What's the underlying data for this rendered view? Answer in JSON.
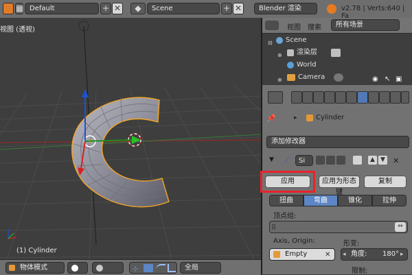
{
  "top_bar": {
    "layout_value": "Default",
    "scene_value": "Scene",
    "engine_value": "Blender 渲染",
    "stats": "v2.78 | Verts:640 | Fa"
  },
  "viewport": {
    "title": "视图 (透视)",
    "object_name": "(1) Cylinder"
  },
  "bottom_bar": {
    "mode_value": "物体模式",
    "orientation_value": "全局"
  },
  "outliner": {
    "menu": [
      "视图",
      "搜索"
    ],
    "filter_value": "所有场景",
    "items": [
      {
        "label": "Scene"
      },
      {
        "label": "渲染层"
      },
      {
        "label": "World"
      },
      {
        "label": "Camera"
      }
    ]
  },
  "properties": {
    "object_name": "Cylinder",
    "add_modifier": "添加修改器",
    "modifier_name": "Si",
    "apply_button": "应用",
    "apply_shape_button": "应用为形态键",
    "copy_button": "复制",
    "deform_modes": [
      "扭曲",
      "弯曲",
      "锥化",
      "拉伸"
    ],
    "selected_mode": "弯曲",
    "vertex_group_label": "顶点组:",
    "axis_origin_label": "Axis, Origin:",
    "deform_label": "形变:",
    "origin_value": "Empty",
    "angle_label": "角度:",
    "angle_value": "180°",
    "limit_label": "限制:"
  },
  "colors": {
    "highlight": "#e8222a",
    "selected_tab": "#5c86c5",
    "object_outline": "#f5a623"
  }
}
